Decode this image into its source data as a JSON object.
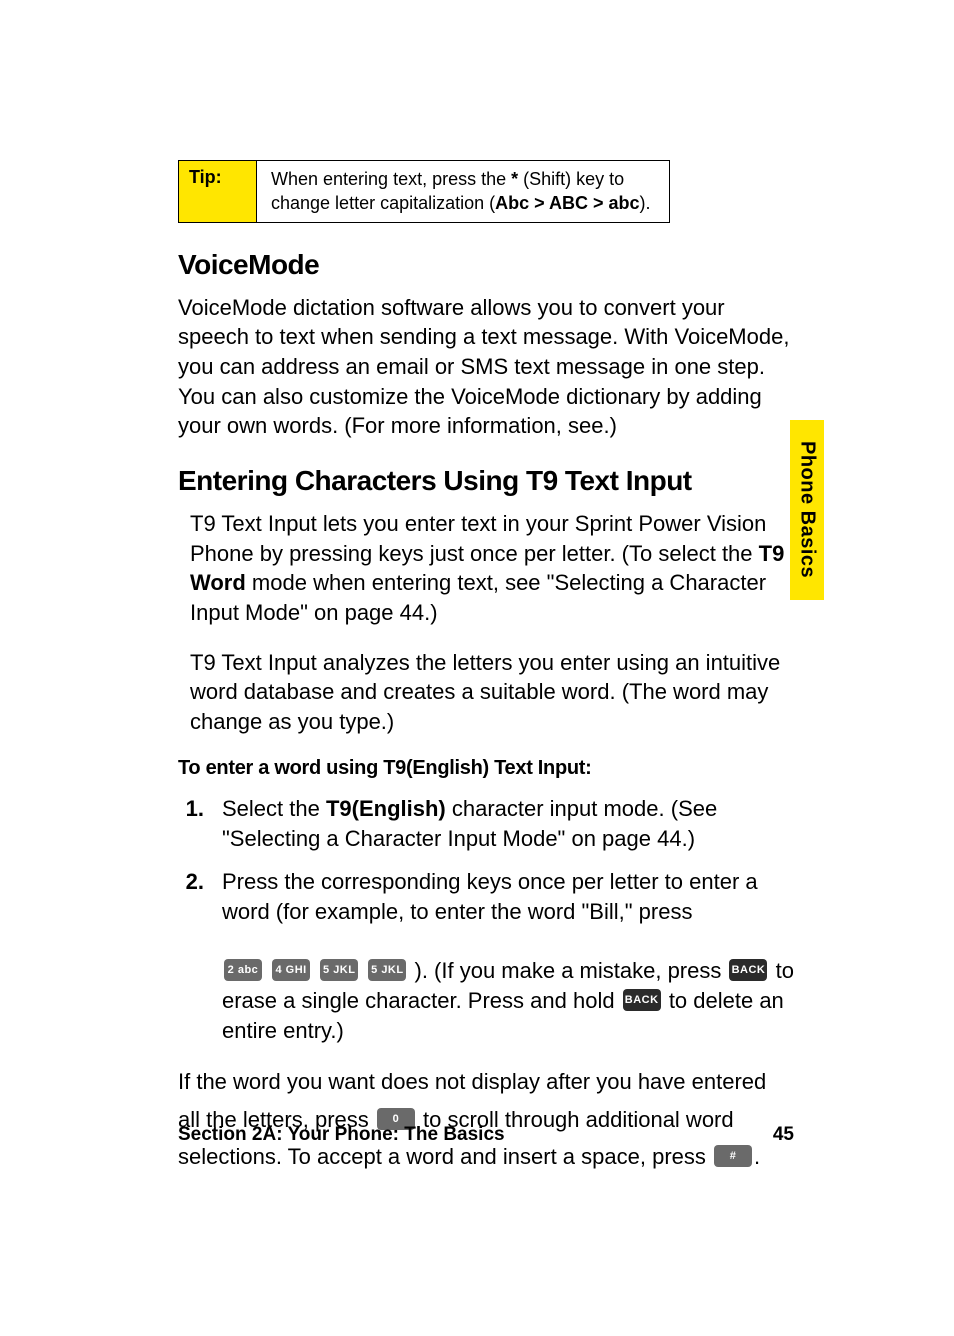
{
  "tip": {
    "label": "Tip:",
    "content_prefix": "When entering text, press the ",
    "content_mid": " (Shift) key to change letter capitalization (",
    "content_suffix": ").",
    "asterisk": "*",
    "caps_sequence": "Abc > ABC > abc"
  },
  "section1": {
    "heading": "VoiceMode",
    "para": "VoiceMode dictation software allows you to convert your speech to text when sending a text message. With VoiceMode, you can address an email or SMS text message in one step. You can also customize the VoiceMode dictionary by adding your own words. (For more information, see.)"
  },
  "section2": {
    "heading": "Entering Characters Using T9 Text Input",
    "para1_a": "T9 Text Input lets you enter text in your Sprint Power Vision Phone by pressing keys just once per letter. (To select the ",
    "para1_bold": "T9 Word",
    "para1_b": " mode when entering text, see \"Selecting a Character Input Mode\" on page 44.)",
    "para2": "T9 Text Input analyzes the letters you enter using an intuitive word database and creates a suitable word. (The word may change as you type.)",
    "subheading": "To enter a word using T9(English) Text Input:",
    "step1_num": "1.",
    "step1_a": "Select the ",
    "step1_bold": "T9(English)",
    "step1_b": " character input mode. (See \"Selecting a Character Input Mode\" on page 44.)",
    "step2_num": "2.",
    "step2_a": "Press the corresponding keys once per letter to enter a word (for example, to enter the word \"Bill,\" press",
    "step2_b": "). (If you make a mistake, press ",
    "step2_c": " to erase a single character. Press and hold ",
    "step2_d": " to delete an entire entry.)",
    "lower_a": "If the word you want does not display after you have entered all the letters, press ",
    "lower_b": " to scroll through additional word selections. To accept a word and insert a space, press ",
    "lower_c": "."
  },
  "keys": {
    "k2": "2 abc",
    "k4": "4 GHI",
    "k5a": "5 JKL",
    "k5b": "5 JKL",
    "back1": "BACK",
    "back2": "BACK",
    "k0": "0",
    "hash": "#"
  },
  "side_tab": "Phone Basics",
  "footer": {
    "left": "Section 2A: Your Phone: The Basics",
    "right": "45"
  }
}
